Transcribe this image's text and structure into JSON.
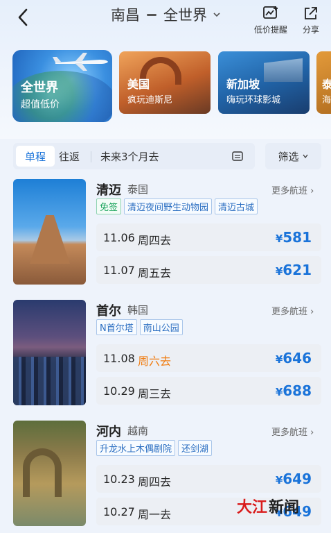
{
  "header": {
    "origin": "南昌",
    "destination": "全世界",
    "actions": [
      {
        "label": "低价提醒",
        "icon": "price-alert-icon"
      },
      {
        "label": "分享",
        "icon": "share-icon"
      }
    ]
  },
  "destinations": [
    {
      "name": "全世界",
      "sub": "超值低价"
    },
    {
      "name": "美国",
      "sub": "疯玩迪斯尼"
    },
    {
      "name": "新加坡",
      "sub": "嗨玩环球影城"
    },
    {
      "name": "泰",
      "sub": "海"
    }
  ],
  "filters": {
    "one_way": "单程",
    "round_trip": "往返",
    "date_range": "未来3个月去",
    "screen": "筛选"
  },
  "results": [
    {
      "city": "清迈",
      "country": "泰国",
      "more": "更多航班",
      "tags": [
        {
          "text": "免签",
          "style": "green"
        },
        {
          "text": "清迈夜间野生动物园",
          "style": "blue"
        },
        {
          "text": "清迈古城",
          "style": "blue"
        }
      ],
      "flights": [
        {
          "date": "11.06",
          "day": "周四去",
          "price": "581",
          "day_highlight": false
        },
        {
          "date": "11.07",
          "day": "周五去",
          "price": "621",
          "day_highlight": false
        }
      ]
    },
    {
      "city": "首尔",
      "country": "韩国",
      "more": "更多航班",
      "tags": [
        {
          "text": "N首尔塔",
          "style": "blue"
        },
        {
          "text": "南山公园",
          "style": "blue"
        }
      ],
      "flights": [
        {
          "date": "11.08",
          "day": "周六去",
          "price": "646",
          "day_highlight": true
        },
        {
          "date": "10.29",
          "day": "周三去",
          "price": "688",
          "day_highlight": false
        }
      ]
    },
    {
      "city": "河内",
      "country": "越南",
      "more": "更多航班",
      "tags": [
        {
          "text": "升龙水上木偶剧院",
          "style": "blue"
        },
        {
          "text": "还剑湖",
          "style": "blue"
        }
      ],
      "flights": [
        {
          "date": "10.23",
          "day": "周四去",
          "price": "649",
          "day_highlight": false
        },
        {
          "date": "10.27",
          "day": "周一去",
          "price": "649",
          "day_highlight": false
        }
      ]
    }
  ],
  "currency_symbol": "¥",
  "watermark": {
    "part1": "大江",
    "part2": "新闻"
  },
  "colors": {
    "accent": "#1a73d9",
    "highlight": "#f07d12",
    "free_visa": "#19a35b"
  }
}
